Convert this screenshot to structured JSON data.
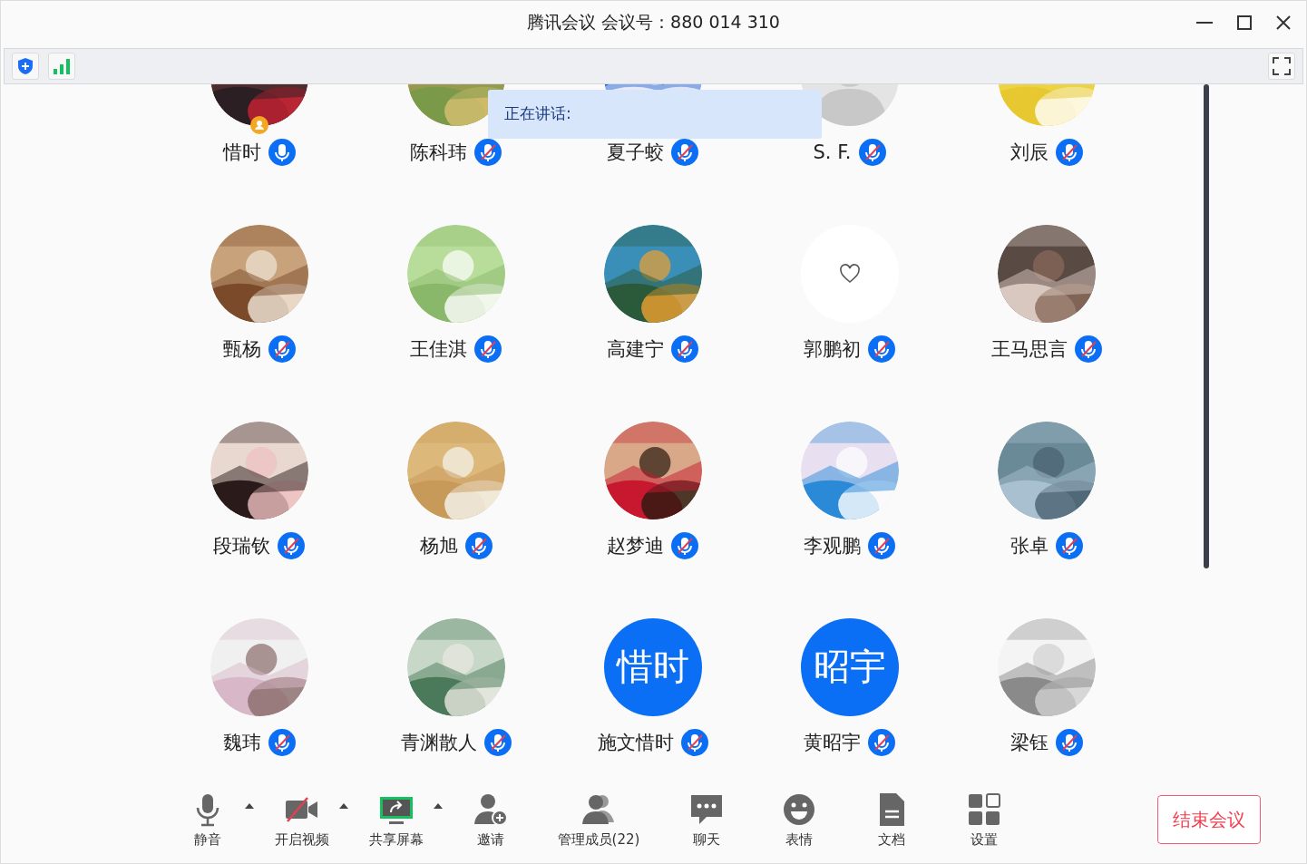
{
  "window": {
    "title": "腾讯会议 会议号：880 014 310"
  },
  "speaking": {
    "label": "正在讲话:"
  },
  "participants": [
    {
      "name": "惜时",
      "kind": "picture",
      "muted": false,
      "host": true
    },
    {
      "name": "陈科玮",
      "kind": "picture",
      "muted": true,
      "host": false
    },
    {
      "name": "夏子蛟",
      "kind": "picture",
      "muted": true,
      "host": false
    },
    {
      "name": "S. F.",
      "kind": "default",
      "muted": true,
      "host": false
    },
    {
      "name": "刘辰",
      "kind": "picture",
      "muted": true,
      "host": false
    },
    {
      "name": "甄杨",
      "kind": "picture",
      "muted": true,
      "host": false
    },
    {
      "name": "王佳淇",
      "kind": "picture",
      "muted": true,
      "host": false
    },
    {
      "name": "高建宁",
      "kind": "picture",
      "muted": true,
      "host": false
    },
    {
      "name": "郭鹏初",
      "kind": "heart",
      "muted": true,
      "host": false
    },
    {
      "name": "王马思言",
      "kind": "picture",
      "muted": true,
      "host": false
    },
    {
      "name": "段瑞钦",
      "kind": "picture",
      "muted": true,
      "host": false
    },
    {
      "name": "杨旭",
      "kind": "picture",
      "muted": true,
      "host": false
    },
    {
      "name": "赵梦迪",
      "kind": "picture",
      "muted": true,
      "host": false
    },
    {
      "name": "李观鹏",
      "kind": "picture",
      "muted": true,
      "host": false
    },
    {
      "name": "张卓",
      "kind": "picture",
      "muted": true,
      "host": false
    },
    {
      "name": "魏玮",
      "kind": "picture",
      "muted": true,
      "host": false
    },
    {
      "name": "青渊散人",
      "kind": "picture",
      "muted": true,
      "host": false
    },
    {
      "name": "施文惜时",
      "kind": "text",
      "initials": "惜时",
      "muted": true,
      "host": false
    },
    {
      "name": "黄昭宇",
      "kind": "text",
      "initials": "昭宇",
      "muted": true,
      "host": false
    },
    {
      "name": "梁钰",
      "kind": "picture",
      "muted": true,
      "host": false
    }
  ],
  "toolbar": [
    {
      "kind": "mic",
      "label": "静音",
      "caret": true
    },
    {
      "kind": "video",
      "label": "开启视频",
      "caret": true
    },
    {
      "kind": "share",
      "label": "共享屏幕",
      "caret": true
    },
    {
      "kind": "invite",
      "label": "邀请",
      "caret": false
    },
    {
      "kind": "members",
      "label": "管理成员(22)",
      "caret": false
    },
    {
      "kind": "chat",
      "label": "聊天",
      "caret": false
    },
    {
      "kind": "emoji",
      "label": "表情",
      "caret": false
    },
    {
      "kind": "doc",
      "label": "文档",
      "caret": false
    },
    {
      "kind": "settings",
      "label": "设置",
      "caret": false
    }
  ],
  "end_button": {
    "label": "结束会议"
  }
}
